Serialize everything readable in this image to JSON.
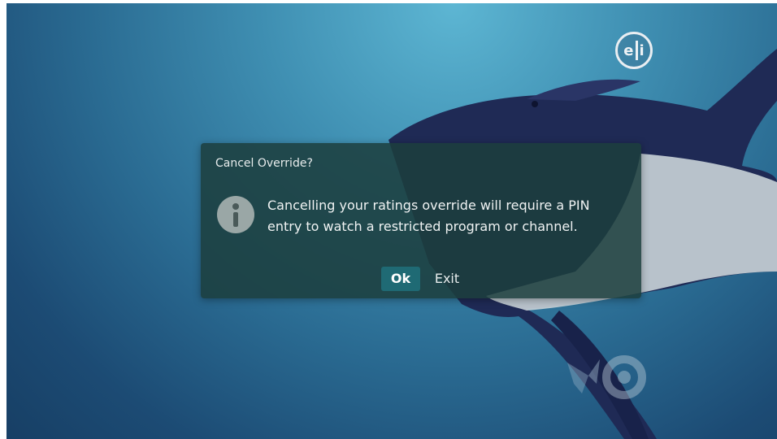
{
  "background": {
    "scene": "underwater shark"
  },
  "rating_badge": {
    "left": "e",
    "right": "i",
    "icon": "rating-ei-icon"
  },
  "network_logo": {
    "icon": "network-watermark-logo"
  },
  "dialog": {
    "title": "Cancel Override?",
    "icon": "info-icon",
    "message": "Cancelling your ratings override will require a PIN entry to watch a restricted program or channel.",
    "ok_label": "Ok",
    "exit_label": "Exit"
  },
  "colors": {
    "dialog_bg": "#1c3e3c",
    "ok_button_bg": "#1f6a74",
    "text": "#f0f3f3"
  }
}
